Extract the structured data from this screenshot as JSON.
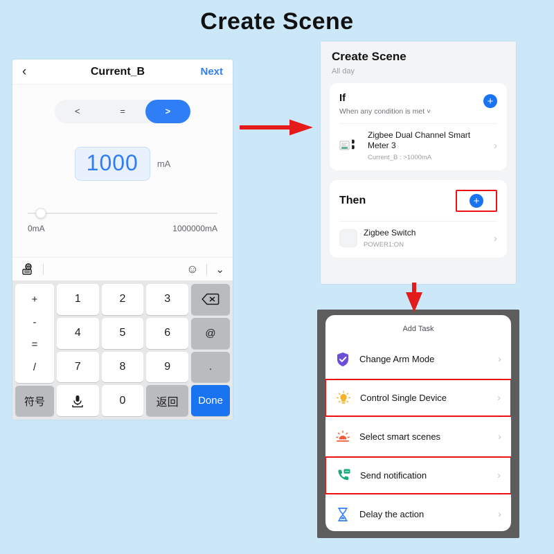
{
  "page": {
    "title": "Create Scene"
  },
  "left_phone": {
    "header": {
      "back_icon": "chevron-left-icon",
      "title": "Current_B",
      "next_label": "Next"
    },
    "comparator": {
      "options": [
        "<",
        "=",
        ">"
      ],
      "selected": ">"
    },
    "value": {
      "amount": "1000",
      "unit": "mA"
    },
    "slider": {
      "min_label": "0mA",
      "max_label": "1000000mA",
      "position_pct": 7
    },
    "keyboard_toolbar": {
      "globe_icon": "keyboard-globe-icon",
      "emoji_icon": "emoji-smiley-icon",
      "collapse_icon": "chevron-down-icon"
    },
    "keypad": {
      "operators": [
        "+",
        "-",
        "=",
        "/"
      ],
      "symbol_key": "符号",
      "digit_rows": [
        [
          "1",
          "2",
          "3"
        ],
        [
          "4",
          "5",
          "6"
        ],
        [
          "7",
          "8",
          "9"
        ]
      ],
      "bottom_row": {
        "mic_icon": "microphone-icon",
        "zero": "0",
        "return_label": "返回",
        "done_label": "Done"
      },
      "right_column": {
        "backspace_icon": "backspace-icon",
        "at_label": "@",
        "dot_label": "."
      }
    }
  },
  "scene_panel": {
    "title": "Create Scene",
    "subtitle": "All day",
    "if_card": {
      "heading": "If",
      "condition_text": "When any condition is met ˅",
      "add_icon": "plus-circle-icon",
      "device": {
        "icon": "energy-meter-icon",
        "name": "Zigbee Dual Channel Smart Meter 3",
        "detail": "Current_B : >1000mA",
        "chevron": "chevron-right-icon"
      }
    },
    "then_card": {
      "heading": "Then",
      "add_icon": "plus-circle-icon",
      "device": {
        "icon": "switch-icon",
        "name": "Zigbee Switch",
        "detail": "POWER1:ON",
        "chevron": "chevron-right-icon"
      }
    }
  },
  "add_task_panel": {
    "title": "Add Task",
    "items": [
      {
        "label": "Change Arm Mode",
        "icon": "shield-check-icon",
        "color": "#6b4fd8",
        "highlighted": false
      },
      {
        "label": "Control Single Device",
        "icon": "light-bulb-icon",
        "color": "#f5b325",
        "highlighted": true
      },
      {
        "label": "Select smart scenes",
        "icon": "sunrise-scene-icon",
        "color": "#ee5a36",
        "highlighted": false
      },
      {
        "label": "Send notification",
        "icon": "phone-message-icon",
        "color": "#19a97a",
        "highlighted": true
      },
      {
        "label": "Delay the action",
        "icon": "hourglass-icon",
        "color": "#2f7ef6",
        "highlighted": false
      }
    ]
  },
  "annotations": {
    "arrow_right": "red-arrow-right",
    "arrow_down": "red-arrow-down",
    "highlight_color": "#ee1111"
  },
  "colors": {
    "background": "#cce8f8",
    "accent": "#1a73f0",
    "link": "#2f7ef6"
  }
}
